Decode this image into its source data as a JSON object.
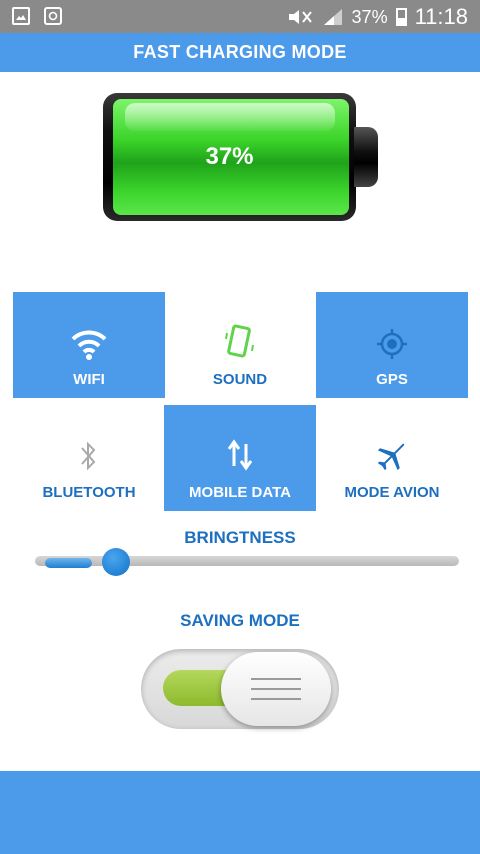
{
  "status_bar": {
    "battery_percent": "37%",
    "time": "11:18"
  },
  "header": {
    "title": "FAST CHARGING MODE"
  },
  "battery": {
    "level_percent": 37,
    "label": "37%",
    "fill_color": "#3cd42a"
  },
  "toggles": [
    {
      "id": "wifi",
      "label": "WIFI",
      "icon": "wifi-icon",
      "active": true
    },
    {
      "id": "sound",
      "label": "SOUND",
      "icon": "vibrate-phone-icon",
      "active": false
    },
    {
      "id": "gps",
      "label": "GPS",
      "icon": "gps-target-icon",
      "active": true
    },
    {
      "id": "bluetooth",
      "label": "BLUETOOTH",
      "icon": "bluetooth-icon",
      "active": false
    },
    {
      "id": "mobile_data",
      "label": "MOBILE DATA",
      "icon": "data-arrows-icon",
      "active": true
    },
    {
      "id": "airplane",
      "label": "MODE AVION",
      "icon": "airplane-icon",
      "active": false
    }
  ],
  "brightness": {
    "title": "BRINGTNESS",
    "level_percent": 17
  },
  "saving_mode": {
    "title": "SAVING MODE",
    "enabled": true
  },
  "colors": {
    "accent": "#4c9bea",
    "label_blue": "#1d6fc0",
    "toggle_green": "#9ccb3f"
  }
}
